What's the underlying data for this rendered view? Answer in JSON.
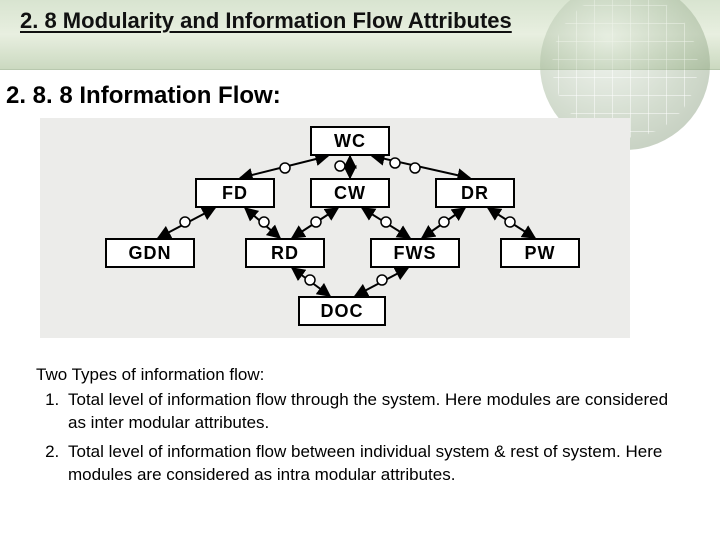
{
  "header": {
    "title": "2. 8 Modularity and Information Flow Attributes"
  },
  "section": {
    "title": "2. 8. 8  Information Flow:"
  },
  "diagram": {
    "nodes": {
      "wc": "WC",
      "fd": "FD",
      "cw": "CW",
      "dr": "DR",
      "gdn": "GDN",
      "rd": "RD",
      "fws": "FWS",
      "pw": "PW",
      "doc": "DOC"
    }
  },
  "body": {
    "intro": "Two Types of information flow:",
    "items": [
      "Total level of information flow through the system. Here modules are considered as inter modular attributes.",
      "Total level of information flow between individual system & rest of system. Here modules are considered as intra modular attributes."
    ]
  }
}
